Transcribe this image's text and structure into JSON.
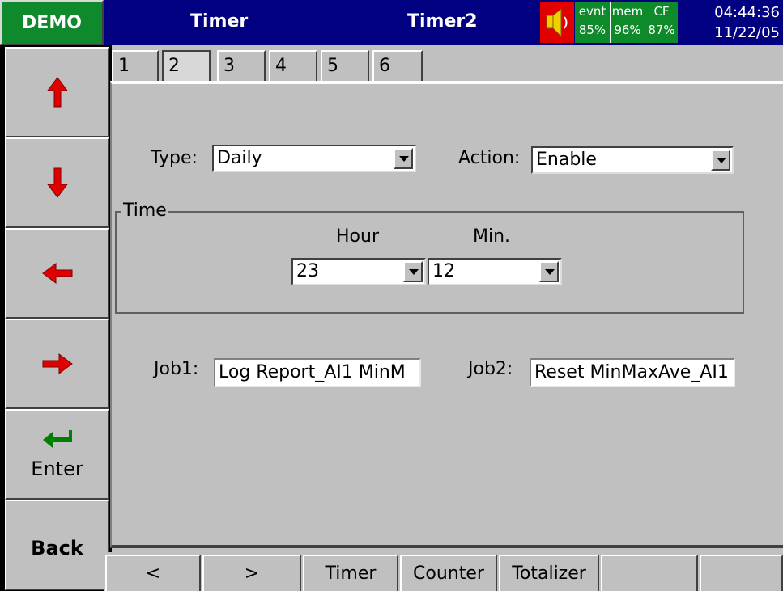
{
  "header": {
    "demo_label": "DEMO",
    "title": "Timer",
    "subtitle": "Timer2",
    "status": {
      "evnt_label": "evnt",
      "evnt_value": "85%",
      "mem_label": "mem",
      "mem_value": "96%",
      "cf_label": "CF",
      "cf_value": "87%"
    },
    "time": "04:44:36",
    "date": "11/22/05"
  },
  "left_buttons": {
    "up": "up-arrow",
    "down": "down-arrow",
    "left": "left-arrow",
    "right": "right-arrow",
    "enter_label": "Enter",
    "back_label": "Back"
  },
  "tabs": [
    "1",
    "2",
    "3",
    "4",
    "5",
    "6"
  ],
  "active_tab": "2",
  "form": {
    "type_label": "Type:",
    "type_value": "Daily",
    "action_label": "Action:",
    "action_value": "Enable",
    "time_group_label": "Time",
    "hour_label": "Hour",
    "min_label": "Min.",
    "hour_value": "23",
    "min_value": "12",
    "job1_label": "Job1:",
    "job1_value": "Log Report_AI1 MinM",
    "job2_label": "Job2:",
    "job2_value": "Reset MinMaxAve_AI1"
  },
  "bottom_buttons": {
    "prev": "<",
    "next": ">",
    "timer": "Timer",
    "counter": "Counter",
    "totalizer": "Totalizer"
  },
  "colors": {
    "demo_green": "#0e8a2c",
    "header_blue": "#000080",
    "arrow_red": "#e00000",
    "enter_green": "#008000"
  }
}
